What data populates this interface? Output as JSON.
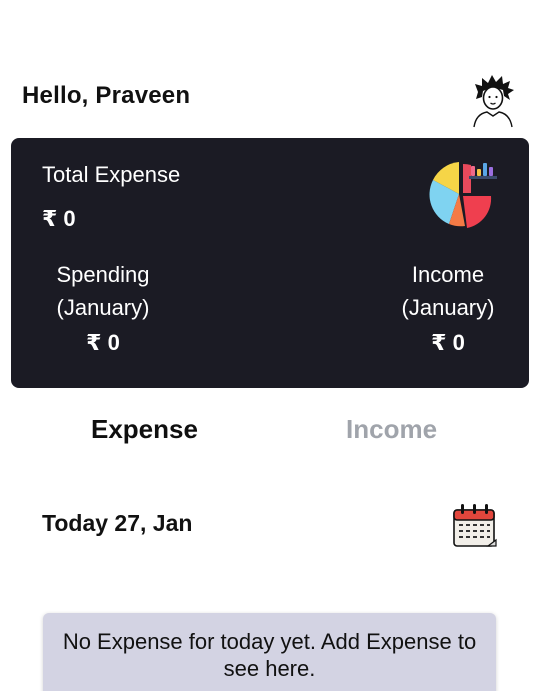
{
  "header": {
    "greeting": "Hello, Praveen",
    "avatar_icon": "user-avatar-icon"
  },
  "summary": {
    "total_label": "Total Expense",
    "total_value": "₹ 0",
    "chart_icon": "pie-chart-icon",
    "spending": {
      "label_line1": "Spending",
      "label_line2": "(January)",
      "value": "₹ 0"
    },
    "income": {
      "label_line1": "Income",
      "label_line2": "(January)",
      "value": "₹ 0"
    },
    "card_color": "#1b1b24"
  },
  "tabs": [
    {
      "label": "Expense",
      "active": true
    },
    {
      "label": "Income",
      "active": false
    }
  ],
  "date_section": {
    "label": "Today 27, Jan",
    "calendar_icon": "calendar-icon"
  },
  "empty_state": {
    "message": "No Expense for today yet. Add Expense to see here.",
    "background": "#d3d3e3"
  },
  "colors": {
    "active_tab": "#0f0f0f",
    "inactive_tab": "#a0a4ab"
  }
}
